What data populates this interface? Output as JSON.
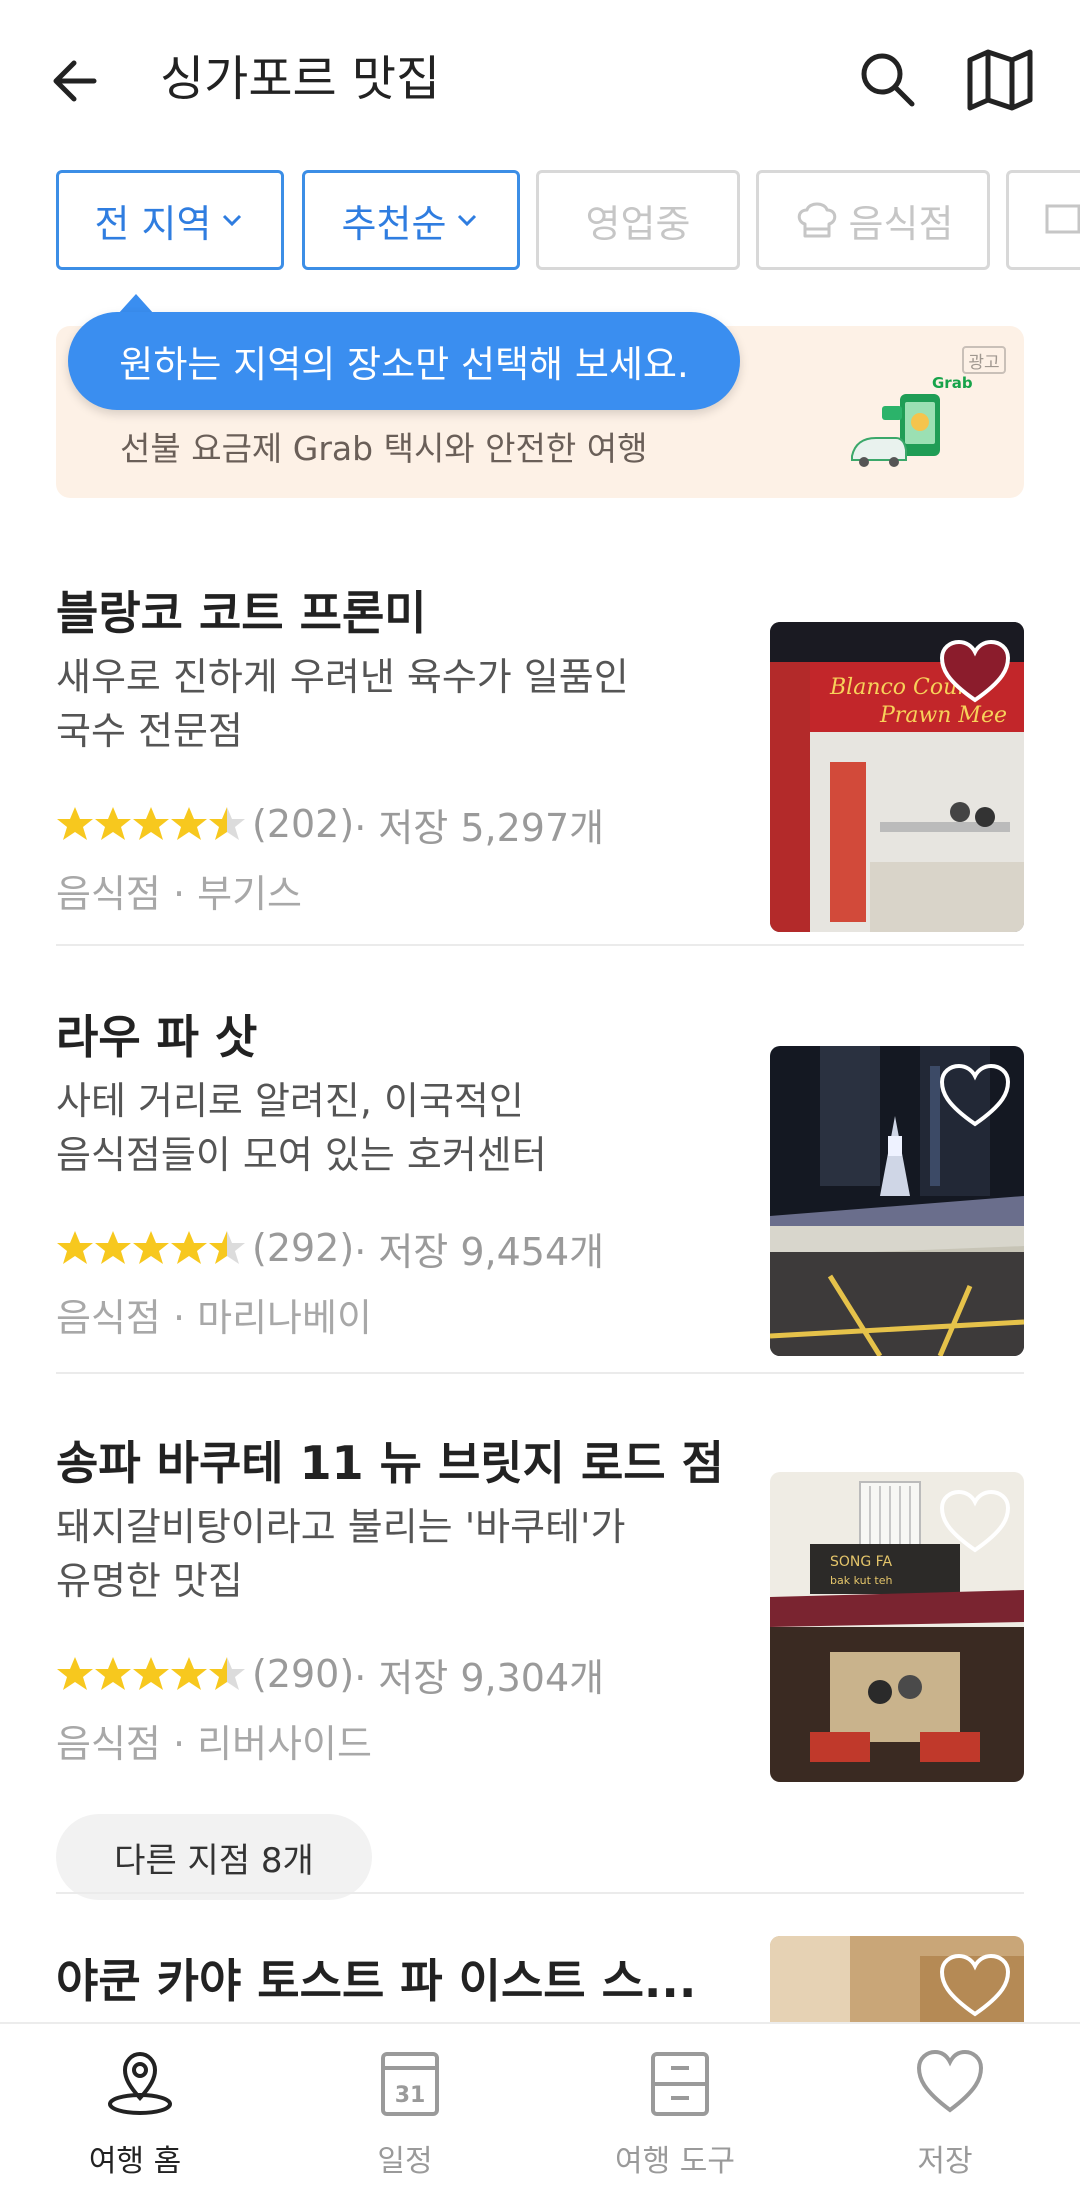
{
  "header": {
    "title": "싱가포르 맛집",
    "back_icon": "arrow-left-icon",
    "search_icon": "search-icon",
    "map_icon": "map-icon"
  },
  "filters": [
    {
      "label": "전 지역",
      "active": true,
      "dropdown": true
    },
    {
      "label": "추천순",
      "active": true,
      "dropdown": true
    },
    {
      "label": "영업중",
      "active": false
    },
    {
      "label": "음식점",
      "active": false,
      "icon": "chef-hat-icon"
    },
    {
      "label": "",
      "active": false
    }
  ],
  "tooltip": {
    "text": "원하는 지역의 장소만 선택해 보세요."
  },
  "banner": {
    "text": "선불 요금제 Grab 택시와 안전한 여행",
    "ad_label": "광고",
    "grab_label": "Grab",
    "background": "#fdf1e6"
  },
  "places": [
    {
      "name": "블랑코 코트 프론미",
      "desc_line1": "새우로 진하게 우려낸 육수가 일품인",
      "desc_line2": "국수 전문점",
      "rating": 4.5,
      "review_count": "(202)",
      "saves": " · 저장 5,297개",
      "category": "음식점 · 부기스",
      "sign_text1": "Blanco Court",
      "sign_text2": "Prawn Mee",
      "liked": true
    },
    {
      "name": "라우 파 삿",
      "desc_line1": "사테 거리로 알려진, 이국적인",
      "desc_line2": "음식점들이 모여 있는 호커센터",
      "rating": 4.5,
      "review_count": "(292)",
      "saves": " · 저장 9,454개",
      "category": "음식점 · 마리나베이",
      "liked": false
    },
    {
      "name": "송파 바쿠테 11 뉴 브릿지 로드 점",
      "desc_line1": "돼지갈비탕이라고 불리는 '바쿠테'가",
      "desc_line2": "유명한 맛집",
      "rating": 4.5,
      "review_count": "(290)",
      "saves": " · 저장 9,304개",
      "category": "음식점 · 리버사이드",
      "sign_text1": "SONG FA",
      "sign_text2": "bak kut teh",
      "branch_label": "다른 지점 8개",
      "liked": false
    },
    {
      "name": "야쿤 카야 토스트 파 이스트 스...",
      "liked": false
    }
  ],
  "tabs": [
    {
      "label": "여행 홈",
      "icon": "map-pin-icon",
      "active": true
    },
    {
      "label": "일정",
      "icon": "calendar-icon",
      "active": false,
      "day": "31"
    },
    {
      "label": "여행 도구",
      "icon": "toolbox-icon",
      "active": false
    },
    {
      "label": "저장",
      "icon": "heart-icon",
      "active": false
    }
  ],
  "colors": {
    "accent": "#2f7de0",
    "tooltip": "#3a8ef0",
    "star": "#f7c81e",
    "liked_heart": "#8b1c2c"
  }
}
